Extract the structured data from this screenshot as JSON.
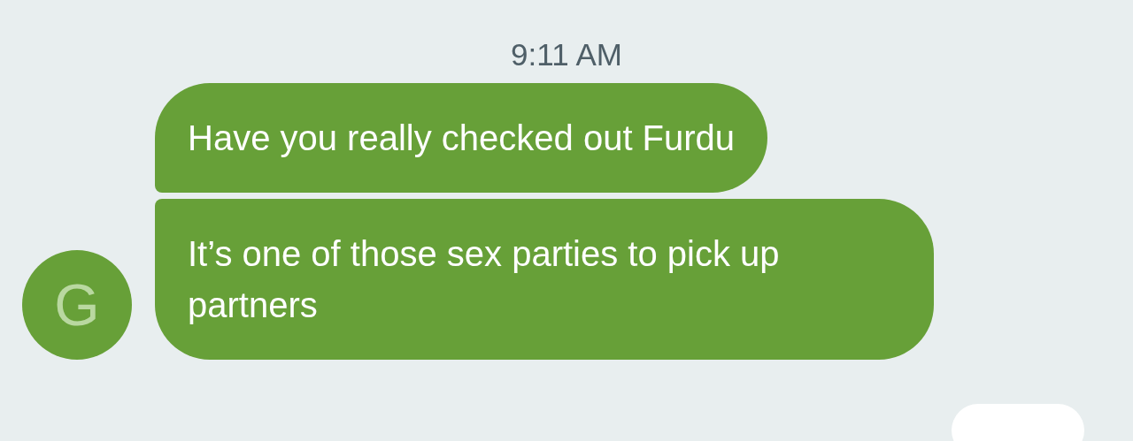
{
  "timestamp": "9:11 AM",
  "sender": {
    "initial": "G"
  },
  "messages": [
    {
      "text": "Have you really checked out Furdu"
    },
    {
      "text": "It’s one of those sex parties to pick up partners"
    }
  ]
}
